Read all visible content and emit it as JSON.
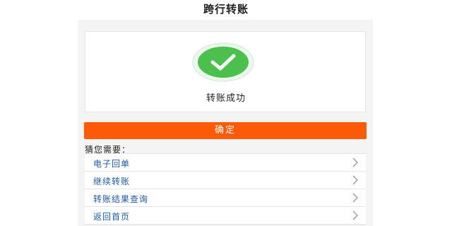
{
  "header": {
    "title": "跨行转账"
  },
  "result": {
    "icon": "check-circle-icon",
    "message": "转账成功",
    "accent_color": "#4cc04c"
  },
  "confirm": {
    "label": "确定",
    "color": "#fd5a07"
  },
  "suggestions": {
    "label": "猜您需要：",
    "items": [
      {
        "label": "电子回单",
        "icon": "chevron-right-icon"
      },
      {
        "label": "继续转账",
        "icon": "chevron-right-icon"
      },
      {
        "label": "转账结果查询",
        "icon": "chevron-right-icon"
      },
      {
        "label": "返回首页",
        "icon": "chevron-right-icon"
      }
    ]
  }
}
